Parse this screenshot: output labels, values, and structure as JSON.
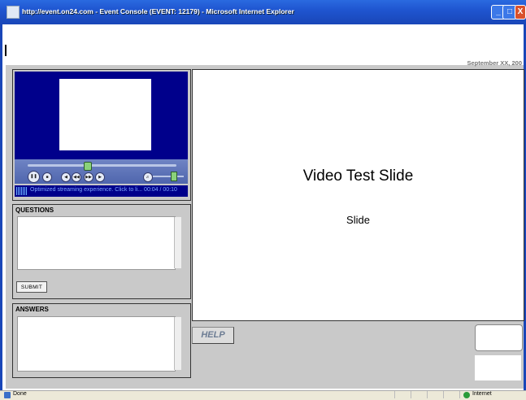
{
  "window": {
    "title": "http://event.on24.com - Event Console (EVENT: 12179) - Microsoft Internet Explorer",
    "minimize": "_",
    "maximize": "□",
    "close": "X"
  },
  "header": {
    "date": "September XX, 200"
  },
  "player": {
    "status_text": "Optimized streaming experience. Click to li...  00:04 / 00:10",
    "controls": [
      "pause",
      "stop",
      "previous",
      "rewind",
      "fast-forward",
      "next",
      "mute"
    ],
    "seek_position": 0.4,
    "volume_level": 0.65
  },
  "questions": {
    "label": "QUESTIONS",
    "submit_label": "SUBMIT"
  },
  "answers": {
    "label": "ANSWERS"
  },
  "slide": {
    "title": "Video Test Slide",
    "subtitle": "Slide"
  },
  "help": {
    "label": "HELP"
  },
  "statusbar": {
    "left_text": "Done",
    "zone_text": "Internet"
  },
  "colors": {
    "titlebar": "#1f55d0",
    "video_bg": "#00008b",
    "panel_bg": "#c9c9c9",
    "help_text": "#6c7c93"
  }
}
